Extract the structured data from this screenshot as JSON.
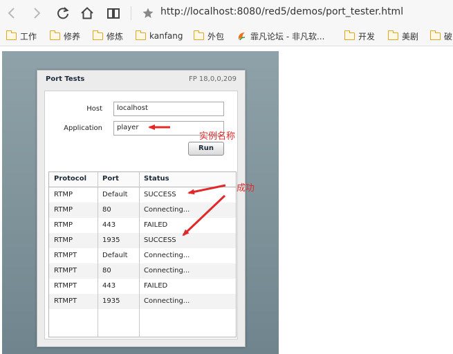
{
  "browser": {
    "url": "http://localhost:8080/red5/demos/port_tester.html",
    "bookmarks": [
      {
        "label": "工作",
        "icon": "folder-icon"
      },
      {
        "label": "修养",
        "icon": "folder-icon"
      },
      {
        "label": "修炼",
        "icon": "folder-icon"
      },
      {
        "label": "kanfang",
        "icon": "folder-icon"
      },
      {
        "label": "外包",
        "icon": "folder-icon"
      },
      {
        "label": "霏凡论坛 - 非凡软...",
        "icon": "site-favicon-icon"
      },
      {
        "label": "开发",
        "icon": "folder-icon"
      },
      {
        "label": "美剧",
        "icon": "folder-icon"
      },
      {
        "label": "破",
        "icon": "folder-icon"
      }
    ]
  },
  "app": {
    "title": "Port Tests",
    "version": "FP 18,0,0,209",
    "host_label": "Host",
    "host_value": "localhost",
    "application_label": "Application",
    "application_value": "player",
    "run_label": "Run",
    "columns": [
      "Protocol",
      "Port",
      "Status"
    ],
    "rows": [
      [
        "RTMP",
        "Default",
        "SUCCESS"
      ],
      [
        "RTMP",
        "80",
        "Connecting..."
      ],
      [
        "RTMP",
        "443",
        "FAILED"
      ],
      [
        "RTMP",
        "1935",
        "SUCCESS"
      ],
      [
        "RTMPT",
        "Default",
        "Connecting..."
      ],
      [
        "RTMPT",
        "80",
        "Connecting..."
      ],
      [
        "RTMPT",
        "443",
        "FAILED"
      ],
      [
        "RTMPT",
        "1935",
        "Connecting..."
      ]
    ]
  },
  "annotations": {
    "instance_name": "实例名称",
    "success": "成功",
    "color": "#e02a2a"
  }
}
